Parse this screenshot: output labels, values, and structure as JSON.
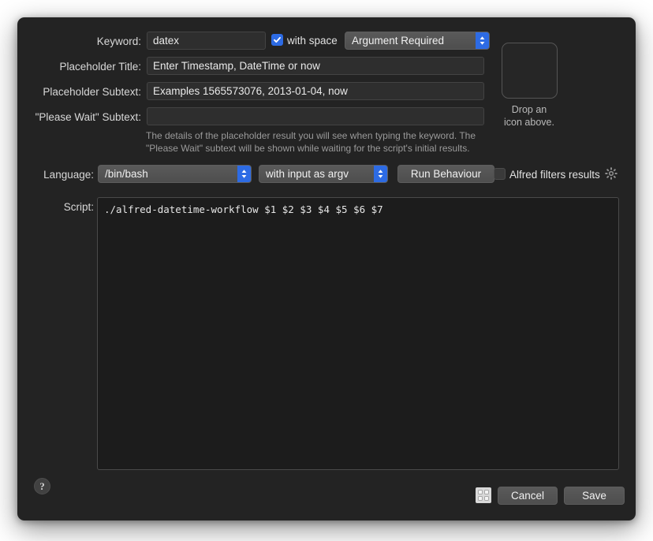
{
  "window": {
    "background_color": "#232323"
  },
  "fields": {
    "keyword": {
      "label": "Keyword:",
      "value": "datex"
    },
    "with_space": {
      "label": "with space",
      "checked": true
    },
    "argument_mode": {
      "value": "Argument Required"
    },
    "placeholder_title": {
      "label": "Placeholder Title:",
      "value": "Enter Timestamp, DateTime or now"
    },
    "placeholder_subtext": {
      "label": "Placeholder Subtext:",
      "value": "Examples 1565573076, 2013-01-04, now"
    },
    "please_wait_subtext": {
      "label": "\"Please Wait\" Subtext:",
      "value": "",
      "placeholder": ""
    }
  },
  "icon_well": {
    "caption_line1": "Drop an",
    "caption_line2": "icon above."
  },
  "helper_text": {
    "line1": "The details of the placeholder result you will see when typing the keyword. The",
    "line2": "\"Please Wait\" subtext will be shown while waiting for the script's initial results."
  },
  "language_row": {
    "label": "Language:",
    "language_value": "/bin/bash",
    "input_mode_value": "with input as argv",
    "run_behaviour_label": "Run Behaviour",
    "alfred_filters_label": "Alfred filters results",
    "alfred_filters_checked": false
  },
  "script": {
    "label": "Script:",
    "content": "./alfred-datetime-workflow $1 $2 $3 $4 $5 $6 $7"
  },
  "footer": {
    "help_label": "?",
    "cancel_label": "Cancel",
    "save_label": "Save"
  },
  "colors": {
    "accent": "#2d6be4",
    "window_bg": "#232323",
    "field_bg": "#2e2e2e",
    "script_bg": "#1c1c1c"
  }
}
